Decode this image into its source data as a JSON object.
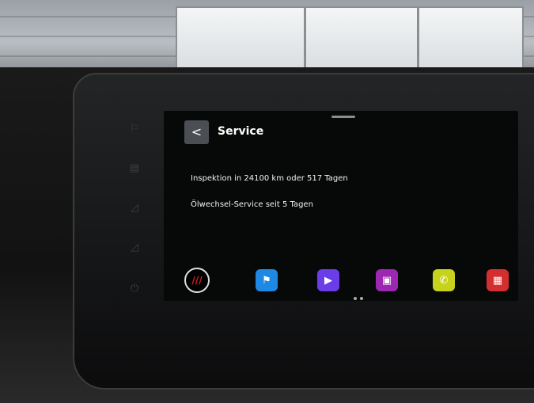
{
  "screen": {
    "title": "Service",
    "back_label": "<",
    "rows": [
      "Inspektion in 24100 km oder 517 Tagen",
      "Ölwechsel-Service seit 5 Tagen"
    ]
  },
  "dock": {
    "apps": [
      {
        "name": "brand-icon",
        "glyph": "///",
        "color": "#000000"
      },
      {
        "name": "flag-icon",
        "glyph": "⚑",
        "color": "#1e88e5"
      },
      {
        "name": "play-icon",
        "glyph": "▶",
        "color": "#6a3de8"
      },
      {
        "name": "radio-icon",
        "glyph": "▣",
        "color": "#9c27b0"
      },
      {
        "name": "phone-icon",
        "glyph": "✆",
        "color": "#c6d21b"
      },
      {
        "name": "keyboard-icon",
        "glyph": "▦",
        "color": "#d32f2f"
      }
    ]
  }
}
